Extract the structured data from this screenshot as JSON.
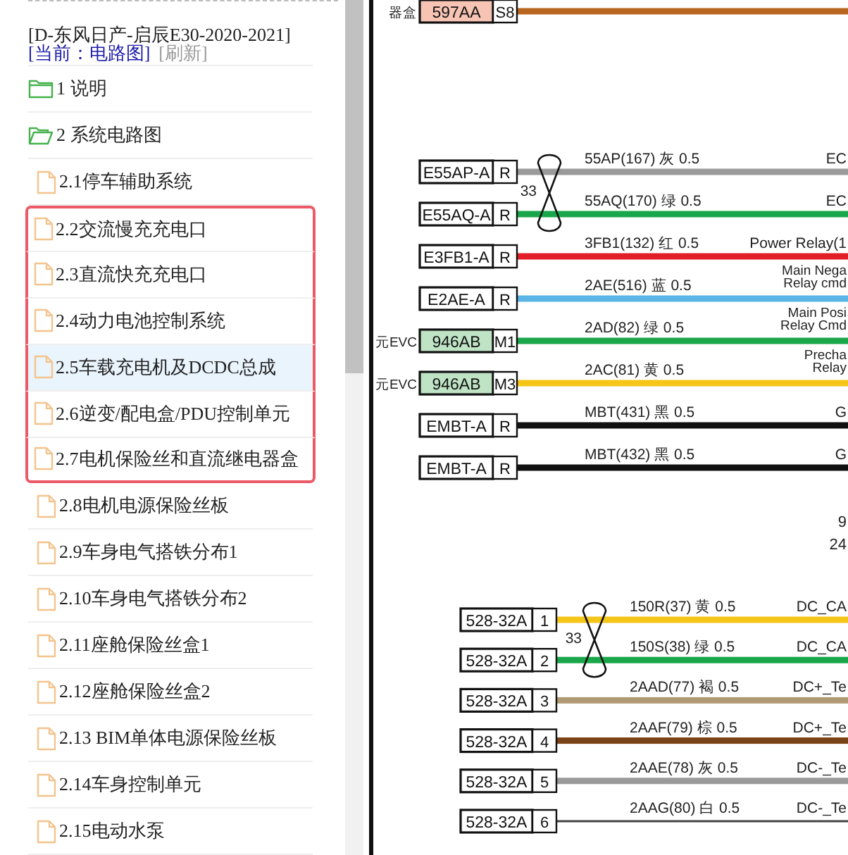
{
  "header": {
    "title": "[D-东风日产-启辰E30-2020-2021]",
    "current": "[当前：电路图]",
    "refresh": "[刷新]"
  },
  "tree": [
    {
      "label": "1 说明",
      "expanded": false
    },
    {
      "label": "2 系统电路图",
      "expanded": true,
      "children": [
        {
          "label": "2.1停车辅助系统",
          "selected": false,
          "highlighted": false
        },
        {
          "label": "2.2交流慢充充电口",
          "selected": false,
          "highlighted": true
        },
        {
          "label": "2.3直流快充充电口",
          "selected": false,
          "highlighted": true
        },
        {
          "label": "2.4动力电池控制系统",
          "selected": false,
          "highlighted": true
        },
        {
          "label": "2.5车载充电机及DCDC总成",
          "selected": true,
          "highlighted": true
        },
        {
          "label": "2.6逆变/配电盒/PDU控制单元",
          "selected": false,
          "highlighted": true
        },
        {
          "label": "2.7电机保险丝和直流继电器盒",
          "selected": false,
          "highlighted": true
        },
        {
          "label": "2.8电机电源保险丝板",
          "selected": false,
          "highlighted": false
        },
        {
          "label": "2.9车身电气搭铁分布1",
          "selected": false,
          "highlighted": false
        },
        {
          "label": "2.10车身电气搭铁分布2",
          "selected": false,
          "highlighted": false
        },
        {
          "label": "2.11座舱保险丝盒1",
          "selected": false,
          "highlighted": false
        },
        {
          "label": "2.12座舱保险丝盒2",
          "selected": false,
          "highlighted": false
        },
        {
          "label": "2.13 BIM单体电源保险丝板",
          "selected": false,
          "highlighted": false
        },
        {
          "label": "2.14车身控制单元",
          "selected": false,
          "highlighted": false
        },
        {
          "label": "2.15电动水泵",
          "selected": false,
          "highlighted": false
        }
      ]
    }
  ],
  "diagram": {
    "sections": [
      {
        "wires": [
          {
            "prefix": "器盒",
            "connector": "597AA",
            "tag": {
              "color": "#f7c4b4"
            },
            "pin": "S8",
            "color": "#b8651f"
          }
        ]
      },
      {
        "twisted_pair": "33",
        "notes": [
          "9",
          "24"
        ],
        "wires": [
          {
            "connector": "E55AP-A",
            "pin": "R",
            "label": "55AP(167) 灰 0.5",
            "end": [
              "EC"
            ],
            "color": "#9a9a9a"
          },
          {
            "connector": "E55AQ-A",
            "pin": "R",
            "label": "55AQ(170) 绿 0.5",
            "end": [
              "EC"
            ],
            "color": "#1aa64a"
          },
          {
            "connector": "E3FB1-A",
            "pin": "R",
            "label": "3FB1(132) 红 0.5",
            "end": [
              "Power Relay(1"
            ],
            "color": "#e21f26"
          },
          {
            "connector": "E2AE-A",
            "pin": "R",
            "label": "2AE(516) 蓝 0.5",
            "end": [
              "Main Nega",
              "Relay cmd"
            ],
            "color": "#5ab4e5"
          },
          {
            "prefix": "元EVC",
            "connector": "946AB",
            "tag": {
              "color": "#bfe3c5"
            },
            "pin": "M1",
            "label": "2AD(82) 绿 0.5",
            "end": [
              "Main Posi",
              "Relay Cmd"
            ],
            "color": "#1aa64a"
          },
          {
            "prefix": "元EVC",
            "connector": "946AB",
            "tag": {
              "color": "#bfe3c5"
            },
            "pin": "M3",
            "label": "2AC(81) 黄 0.5",
            "end": [
              "Precha",
              "Relay"
            ],
            "color": "#f5c518"
          },
          {
            "connector": "EMBT-A",
            "pin": "R",
            "label": "MBT(431) 黑 0.5",
            "end": [
              "G"
            ],
            "color": "#111111"
          },
          {
            "connector": "EMBT-A",
            "pin": "R",
            "label": "MBT(432) 黑 0.5",
            "end": [
              "G"
            ],
            "color": "#111111"
          }
        ]
      },
      {
        "twisted_pair": "33",
        "wires": [
          {
            "connector": "528-32A",
            "pin": "1",
            "label": "150R(37) 黄 0.5",
            "end": [
              "DC_CA"
            ],
            "color": "#f5c518"
          },
          {
            "connector": "528-32A",
            "pin": "2",
            "label": "150S(38) 绿 0.5",
            "end": [
              "DC_CA"
            ],
            "color": "#1aa64a"
          },
          {
            "connector": "528-32A",
            "pin": "3",
            "label": "2AAD(77) 褐 0.5",
            "end": [
              "DC+_Te"
            ],
            "color": "#b09a74"
          },
          {
            "connector": "528-32A",
            "pin": "4",
            "label": "2AAF(79) 棕 0.5",
            "end": [
              "DC+_Te"
            ],
            "color": "#7a4216"
          },
          {
            "connector": "528-32A",
            "pin": "5",
            "label": "2AAE(78) 灰 0.5",
            "end": [
              "DC-_Te"
            ],
            "color": "#9a9a9a"
          },
          {
            "connector": "528-32A",
            "pin": "6",
            "label": "2AAG(80) 白 0.5",
            "end": [
              "DC-_Te"
            ],
            "color": "#444444"
          }
        ]
      }
    ]
  }
}
